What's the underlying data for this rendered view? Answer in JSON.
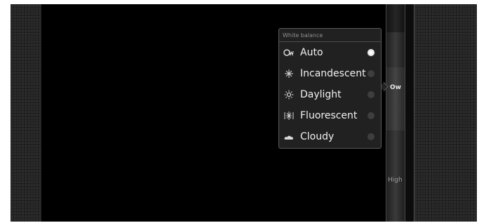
{
  "settings_popup": {
    "title": "White balance",
    "options": [
      {
        "label": "Auto",
        "icon": "auto-white-balance-icon",
        "selected": true
      },
      {
        "label": "Incandescent",
        "icon": "incandescent-icon",
        "selected": false
      },
      {
        "label": "Daylight",
        "icon": "daylight-icon",
        "selected": false
      },
      {
        "label": "Fluorescent",
        "icon": "fluorescent-icon",
        "selected": false
      },
      {
        "label": "Cloudy",
        "icon": "cloudy-icon",
        "selected": false
      }
    ]
  },
  "settings_bar": {
    "white_balance_badge": "Ow",
    "quality_label": "High"
  },
  "camera_controls": {
    "mode": "video",
    "shutter_color": "#d90f0f"
  }
}
